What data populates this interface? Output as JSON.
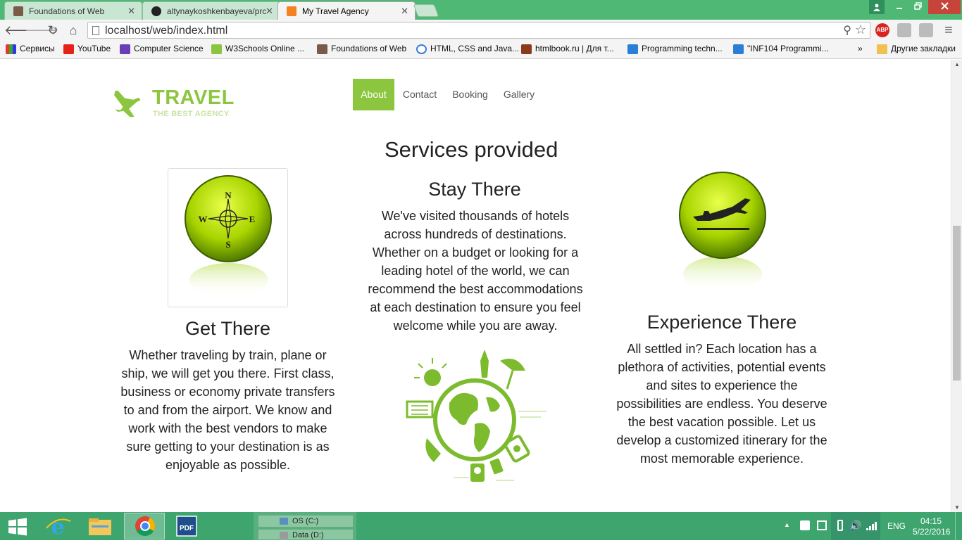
{
  "browser": {
    "tabs": [
      {
        "title": "Foundations of Web",
        "active": false
      },
      {
        "title": "altynaykoshkenbayeva/prс",
        "active": false
      },
      {
        "title": "My Travel Agency",
        "active": true
      }
    ],
    "address": "localhost/web/index.html",
    "extensions": {
      "abp": "ABP"
    },
    "bookmarks": [
      "Сервисы",
      "YouTube",
      "Computer Science",
      "W3Schools Online ...",
      "Foundations of Web",
      "HTML, CSS and Java...",
      "htmlbook.ru | Для т...",
      "Programming techn...",
      "\"INF104 Programmi...",
      "Другие закладки"
    ],
    "more_bookmarks": "»"
  },
  "site": {
    "logo_title": "TRAVEL",
    "logo_tagline": "THE BEST AGENCY",
    "nav": [
      {
        "label": "About",
        "active": true
      },
      {
        "label": "Contact",
        "active": false
      },
      {
        "label": "Booking",
        "active": false
      },
      {
        "label": "Gallery",
        "active": false
      }
    ],
    "heading": "Services provided",
    "compass_letters": {
      "n": "N",
      "s": "S",
      "w": "W",
      "e": "E"
    },
    "services": [
      {
        "title": "Get There",
        "lines": [
          "Whether traveling by train, plane or",
          "ship, we will get you there. First class,",
          "business or economy private transfers",
          "to and from the airport. We know and",
          "work with the best vendors to make",
          "sure getting to your destination is as",
          "enjoyable as possible."
        ]
      },
      {
        "title": "Stay There",
        "lines": [
          "We've visited thousands of hotels",
          "across hundreds of destinations.",
          "Whether on a budget or looking for a",
          "leading hotel of the world, we can",
          "recommend the best accommodations",
          "at each destination to ensure you feel",
          "welcome while you are away."
        ]
      },
      {
        "title": "Experience There",
        "lines": [
          "All settled in? Each location has a",
          "plethora of activities, potential events",
          "and sites to experience the",
          "possibilities are endless. You deserve",
          "the best vacation possible. Let us",
          "develop a customized itinerary for the",
          "most memorable experience."
        ]
      }
    ],
    "accent_color": "#8cc63f"
  },
  "taskbar": {
    "drives": [
      "OS (C:)",
      "Data (D:)"
    ],
    "language": "ENG",
    "time": "04:15",
    "date": "5/22/2016",
    "pdf_label": "PDF"
  }
}
